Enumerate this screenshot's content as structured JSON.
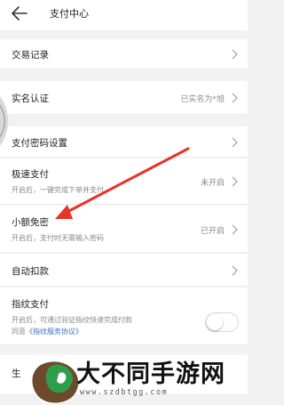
{
  "header": {
    "title": "支付中心",
    "back_icon": "back-arrow-icon"
  },
  "rows": {
    "transactions": {
      "label": "交易记录",
      "icon": "chevron-right-icon"
    },
    "realname": {
      "label": "实名认证",
      "value": "已实名为*旭",
      "icon": "chevron-right-icon"
    },
    "paypassword": {
      "label": "支付密码设置",
      "icon": "chevron-right-icon"
    },
    "fastpay": {
      "label": "极速支付",
      "desc": "开启后，一键完成下单并支付",
      "value": "未开启",
      "icon": "chevron-right-icon"
    },
    "smallfree": {
      "label": "小额免密",
      "desc": "开启后，支付时无需输入密码",
      "value": "已开启",
      "icon": "chevron-right-icon"
    },
    "autodeduct": {
      "label": "自动扣款",
      "icon": "chevron-right-icon"
    },
    "fingerprint": {
      "label": "指纹支付",
      "desc": "开启后，可通过验证指纹快速完成付款",
      "agree_prefix": "同意",
      "agree_link": "《指纹服务协议》",
      "toggle_on": false
    },
    "partial": {
      "label": "生"
    }
  },
  "annotation": {
    "arrow_color": "#e8332a"
  },
  "watermark": {
    "text": "大不同手游网",
    "url": "www.szdbtgg.com"
  },
  "colors": {
    "background": "#f2f2f2",
    "link": "#3a6fc4",
    "secondary_text": "#8a8a8a"
  }
}
